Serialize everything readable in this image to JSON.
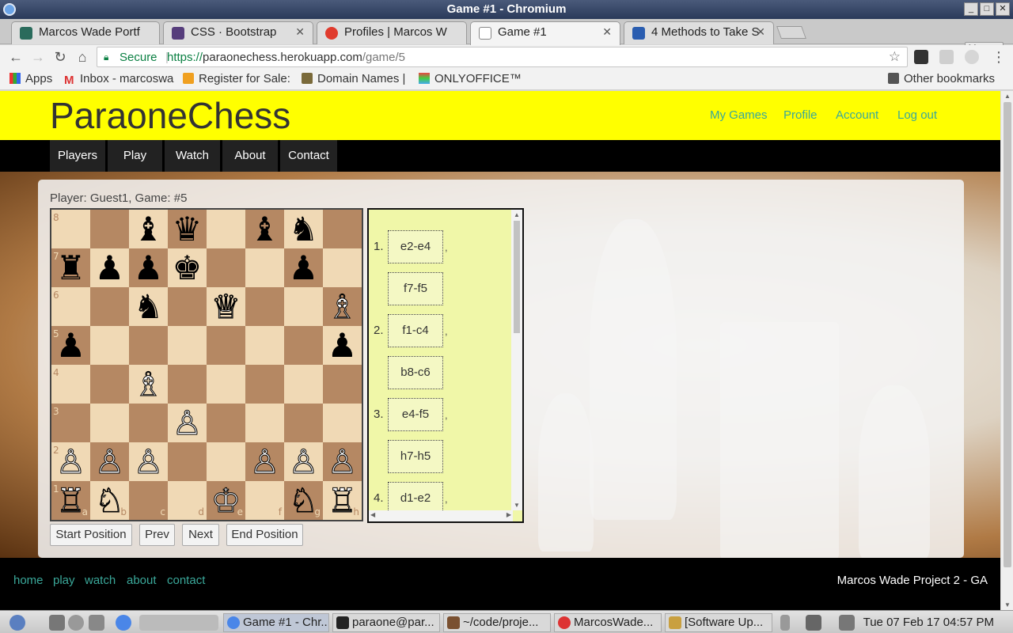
{
  "window": {
    "title": "Game #1 - Chromium"
  },
  "tabs": [
    {
      "label": "Marcos Wade Portf",
      "color": "#2a6b5c"
    },
    {
      "label": "CSS · Bootstrap",
      "color": "#563d7c"
    },
    {
      "label": "Profiles | Marcos W",
      "color": "#e03b2d"
    },
    {
      "label": "Game #1",
      "color": "#ffffff"
    },
    {
      "label": "4 Methods to Take S",
      "color": "#2a5db0"
    }
  ],
  "profile": "Marcos",
  "toolbar": {
    "secure_label": "Secure",
    "url_scheme": "https://",
    "url_host": "paraonechess.herokuapp.com",
    "url_path": "/game/5"
  },
  "bookmarks": [
    {
      "label": "Apps"
    },
    {
      "label": "Inbox - marcoswa"
    },
    {
      "label": "Register for Sale:"
    },
    {
      "label": "Domain Names |"
    },
    {
      "label": "ONLYOFFICE™"
    },
    {
      "label": "Other bookmarks"
    }
  ],
  "site": {
    "brand": "ParaoneChess",
    "top_links": [
      "My Games",
      "Profile",
      "Account",
      "Log out"
    ],
    "nav": [
      "Players",
      "Play",
      "Watch",
      "About",
      "Contact"
    ],
    "player_line": "Player: Guest1, Game: #5",
    "controls": [
      "Start Position",
      "Prev",
      "Next",
      "End Position"
    ],
    "footer_links": [
      "home",
      "play",
      "watch",
      "about",
      "contact"
    ],
    "footer_credit": "Marcos Wade Project 2 - GA"
  },
  "board": {
    "ranks": [
      "8",
      "7",
      "6",
      "5",
      "4",
      "3",
      "2",
      "1"
    ],
    "files": [
      "a",
      "b",
      "c",
      "d",
      "e",
      "f",
      "g",
      "h"
    ],
    "rows": [
      [
        "",
        "",
        "b:♝",
        "b:♛",
        "",
        "b:♝",
        "b:♞",
        ""
      ],
      [
        "b:♜",
        "b:♟",
        "b:♟",
        "b:♚",
        "",
        "",
        "b:♟",
        ""
      ],
      [
        "",
        "",
        "b:♞",
        "",
        "w:♕",
        "",
        "",
        "w:♗"
      ],
      [
        "b:♟",
        "",
        "",
        "",
        "",
        "",
        "",
        "b:♟"
      ],
      [
        "",
        "",
        "w:♗",
        "",
        "",
        "",
        "",
        ""
      ],
      [
        "",
        "",
        "",
        "w:♙",
        "",
        "",
        "",
        ""
      ],
      [
        "w:♙",
        "w:♙",
        "w:♙",
        "",
        "",
        "w:♙",
        "w:♙",
        "w:♙"
      ],
      [
        "w:♖",
        "w:♘",
        "",
        "",
        "w:♔",
        "",
        "w:♘",
        "w:♖"
      ]
    ]
  },
  "moves": [
    {
      "num": "1.",
      "move": "e2-e4",
      "comma": ","
    },
    {
      "num": "",
      "move": "f7-f5",
      "comma": ""
    },
    {
      "num": "2.",
      "move": "f1-c4",
      "comma": ","
    },
    {
      "num": "",
      "move": "b8-c6",
      "comma": ""
    },
    {
      "num": "3.",
      "move": "e4-f5",
      "comma": ","
    },
    {
      "num": "",
      "move": "h7-h5",
      "comma": ""
    },
    {
      "num": "4.",
      "move": "d1-e2",
      "comma": ","
    }
  ],
  "taskbar": {
    "windows": [
      "Game #1 - Chr...",
      "paraone@par...",
      "~/code/proje...",
      "MarcosWade...",
      "[Software Up..."
    ],
    "clock": "Tue 07 Feb 17  04:57 PM"
  }
}
